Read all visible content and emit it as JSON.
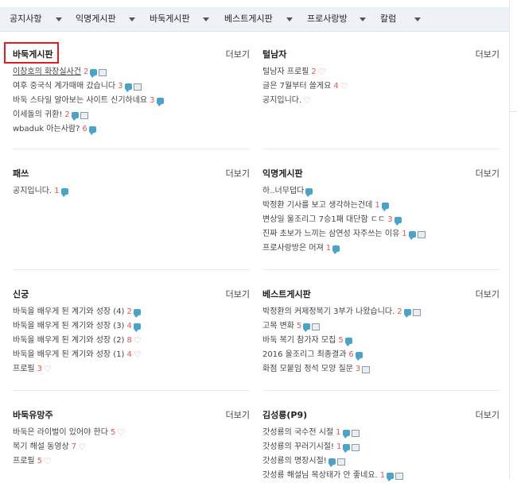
{
  "nav": {
    "items": [
      "공지사항",
      "익명게시판",
      "바둑게시판",
      "베스트게시판",
      "프로사랑방",
      "칼럼"
    ]
  },
  "more_label": "더보기",
  "boards": [
    {
      "title": "바둑게시판",
      "posts": [
        {
          "title": "이창호의 화장실사건",
          "count": "2",
          "icons": [
            "chat-icon",
            "image-icon"
          ]
        },
        {
          "title": "여후 중국식 계가때매 갔습니다",
          "count": "3",
          "icons": [
            "chat-icon",
            "image-icon"
          ]
        },
        {
          "title": "바둑 스타일 알아보는 사이트 신기하네요",
          "count": "3",
          "icons": [
            "chat-icon"
          ]
        },
        {
          "title": "이세돌의 귀환!",
          "count": "2",
          "icons": [
            "chat-icon",
            "image-icon"
          ]
        },
        {
          "title": "wbaduk 아는사람?",
          "count": "6",
          "icons": [
            "chat-icon"
          ]
        }
      ]
    },
    {
      "title": "털남자",
      "posts": [
        {
          "title": "털남자 프로필",
          "count": "2",
          "icons": [
            "heart-icon"
          ]
        },
        {
          "title": "글은 7월부터 쓸게요",
          "count": "4",
          "icons": [
            "heart-icon"
          ]
        },
        {
          "title": "공지입니다.",
          "count": "",
          "icons": [
            "heart-icon"
          ]
        }
      ]
    },
    {
      "title": "패쓰",
      "posts": [
        {
          "title": "공지입니다.",
          "count": "1",
          "icons": [
            "chat-icon"
          ]
        }
      ]
    },
    {
      "title": "익명게시판",
      "posts": [
        {
          "title": "하..너무덥다",
          "count": "",
          "icons": [
            "chat-icon"
          ]
        },
        {
          "title": "박정환 기사를 보고 생각하는건데",
          "count": "1",
          "icons": [
            "chat-icon"
          ]
        },
        {
          "title": "변상일 울조리그 7승1패 대단함 ㄷㄷ",
          "count": "3",
          "icons": [
            "chat-icon"
          ]
        },
        {
          "title": "진짜 초보가 느끼는 삼연성 자주쓰는 이유",
          "count": "1",
          "icons": [
            "chat-icon",
            "image-icon"
          ]
        },
        {
          "title": "프로사랑방은 머져",
          "count": "1",
          "icons": [
            "chat-icon"
          ]
        }
      ]
    },
    {
      "title": "신궁",
      "posts": [
        {
          "title": "바둑을 배우게 된 계기와 성장 (4)",
          "count": "2",
          "icons": [
            "chat-icon"
          ]
        },
        {
          "title": "바둑을 배우게 된 계기와 성장 (3)",
          "count": "4",
          "icons": [
            "chat-icon"
          ]
        },
        {
          "title": "바둑을 배우게 된 계기와 성장 (2)",
          "count": "8",
          "icons": [
            "heart-icon"
          ]
        },
        {
          "title": "바둑을 배우게 된 계기와 성장 (1)",
          "count": "4",
          "icons": [
            "heart-icon"
          ]
        },
        {
          "title": "프로필",
          "count": "3",
          "icons": [
            "heart-icon"
          ]
        }
      ]
    },
    {
      "title": "베스트게시판",
      "posts": [
        {
          "title": "박정환의 커제정복기 3부가 나왔습니다.",
          "count": "2",
          "icons": [
            "chat-icon",
            "image-icon"
          ]
        },
        {
          "title": "고목 변화",
          "count": "5",
          "icons": [
            "chat-icon",
            "image-icon"
          ]
        },
        {
          "title": "바둑 복기 참가자 모집",
          "count": "5",
          "icons": [
            "chat-icon"
          ]
        },
        {
          "title": "2016 울조리그 최종결과",
          "count": "6",
          "icons": [
            "chat-icon"
          ]
        },
        {
          "title": "화점 모붙임 정석 모양 질문",
          "count": "3",
          "icons": [
            "image-icon"
          ]
        }
      ]
    },
    {
      "title": "바둑유망주",
      "posts": [
        {
          "title": "바둑은 라이벌이 있어야 한다",
          "count": "5",
          "icons": [
            "heart-icon"
          ]
        },
        {
          "title": "복기 해설 동영상",
          "count": "7",
          "icons": [
            "heart-icon"
          ]
        },
        {
          "title": "프로필",
          "count": "5",
          "icons": [
            "heart-icon"
          ]
        }
      ]
    },
    {
      "title": "김성룡(P9)",
      "posts": [
        {
          "title": "갓성룡의 국수전 시절",
          "count": "1",
          "icons": [
            "chat-icon",
            "image-icon"
          ]
        },
        {
          "title": "갓성룡의 꾸러기시절!",
          "count": "1",
          "icons": [
            "chat-icon",
            "image-icon"
          ]
        },
        {
          "title": "갓성룡의 명장시절!",
          "count": "",
          "icons": [
            "chat-icon",
            "image-icon"
          ]
        },
        {
          "title": "갓성룡 해설님 목상태가 안 좋네요.",
          "count": "1",
          "icons": [
            "chat-icon",
            "image-icon"
          ]
        }
      ]
    }
  ]
}
